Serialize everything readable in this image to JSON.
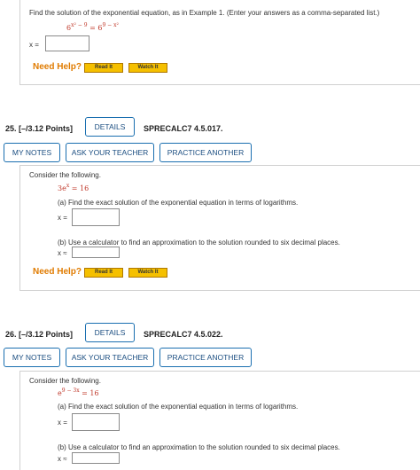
{
  "q24": {
    "prompt": "Find the solution of the exponential equation, as in Example 1. (Enter your answers as a comma-separated list.)",
    "eq_left_base": "6",
    "eq_left_exp": "x² − 9",
    "eq_mid": " = ",
    "eq_right_base": "6",
    "eq_right_exp": "9 − x²",
    "answer_label": "x =",
    "answer_value": ""
  },
  "help": {
    "need_help": "Need Help?",
    "read_it": "Read It",
    "watch_it": "Watch It"
  },
  "q25": {
    "number": "25.",
    "points": "[–/3.12 Points]",
    "details": "DETAILS",
    "code": "SPRECALC7 4.5.017.",
    "my_notes": "MY NOTES",
    "ask_teacher": "ASK YOUR TEACHER",
    "practice": "PRACTICE ANOTHER",
    "consider": "Consider the following.",
    "eq_base": "3e",
    "eq_exp": "x",
    "eq_rest": " = 16",
    "part_a": "(a) Find the exact solution of the exponential equation in terms of logarithms.",
    "a_label": "x =",
    "part_b": "(b) Use a calculator to find an approximation to the solution rounded to six decimal places.",
    "b_label": "x ≈"
  },
  "q26": {
    "number": "26.",
    "points": "[–/3.12 Points]",
    "details": "DETAILS",
    "code": "SPRECALC7 4.5.022.",
    "my_notes": "MY NOTES",
    "ask_teacher": "ASK YOUR TEACHER",
    "practice": "PRACTICE ANOTHER",
    "consider": "Consider the following.",
    "eq_base": "e",
    "eq_exp": "9 − 3x",
    "eq_rest": " = 16",
    "part_a": "(a) Find the exact solution of the exponential equation in terms of logarithms.",
    "a_label": "x =",
    "part_b": "(b) Use a calculator to find an approximation to the solution rounded to six decimal places.",
    "b_label": "x ≈"
  },
  "colors": {
    "accent": "#1a6fb0",
    "help": "#e07b00",
    "button": "#f5c000",
    "equation": "#c0392b"
  }
}
